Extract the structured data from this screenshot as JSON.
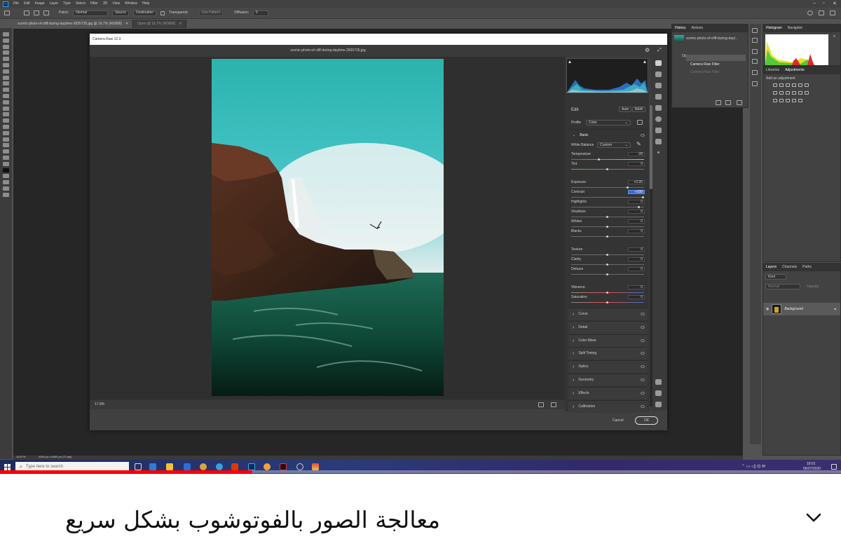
{
  "menu": [
    "File",
    "Edit",
    "Image",
    "Layer",
    "Type",
    "Select",
    "Filter",
    "3D",
    "View",
    "Window",
    "Help"
  ],
  "options": {
    "patch_label": "Patch:",
    "patch_value": "Normal",
    "source": "Source",
    "destination": "Destination",
    "transparent": "Transparent",
    "use_pattern": "Use Pattern",
    "diffusion_label": "Diffusion:",
    "diffusion_value": "5"
  },
  "doc_tabs": [
    "scenic-photo-of-cliff-during-daytime-2835735.jpg @ 16.7% (RGB/8)",
    "Open @ 16.7% (RGB/8)"
  ],
  "camera_raw": {
    "title": "Camera Raw 12.3",
    "filename": "scenic-photo-of-cliff-during-daytime-2835735.jpg",
    "zoom": "17.8%",
    "cancel": "Cancel",
    "ok": "OK"
  },
  "edit_panel": {
    "title": "Edit",
    "auto": "Auto",
    "bw": "B&W",
    "profile_label": "Profile",
    "profile_value": "Color",
    "basic": "Basic",
    "white_balance_label": "White Balance",
    "white_balance_value": "Custom",
    "sliders": [
      {
        "label": "Temperature",
        "value": "-28",
        "pos": 0.38
      },
      {
        "label": "Tint",
        "value": "0",
        "pos": 0.5
      },
      {
        "label": "Exposure",
        "value": "+0.95",
        "pos": 0.78
      },
      {
        "label": "Contrast",
        "value": "+100",
        "pos": 1.0,
        "highlight": true
      },
      {
        "label": "Highlights",
        "value": "0",
        "pos": 0.94
      },
      {
        "label": "Shadows",
        "value": "0",
        "pos": 0.5
      },
      {
        "label": "Whites",
        "value": "0",
        "pos": 0.5
      },
      {
        "label": "Blacks",
        "value": "0",
        "pos": 0.5
      },
      {
        "label": "Texture",
        "value": "0",
        "pos": 0.5
      },
      {
        "label": "Clarity",
        "value": "0",
        "pos": 0.5
      },
      {
        "label": "Dehaze",
        "value": "0",
        "pos": 0.5
      },
      {
        "label": "Vibrance",
        "value": "0",
        "pos": 0.5
      },
      {
        "label": "Saturation",
        "value": "0",
        "pos": 0.5
      }
    ],
    "sections": [
      "Curve",
      "Detail",
      "Color Mixer",
      "Split Toning",
      "Optics",
      "Geometry",
      "Effects",
      "Calibration"
    ]
  },
  "history": {
    "tabs": [
      "History",
      "Actions"
    ],
    "snapshot": "scenic-photo-of-cliff-during-dayt...",
    "items": [
      "Open",
      "Camera Raw Filter",
      "Camera Raw Filter"
    ]
  },
  "histogram_panel": {
    "tabs": [
      "Histogram",
      "Navigator"
    ]
  },
  "adjustments_panel": {
    "tabs": [
      "Libraries",
      "Adjustments"
    ],
    "add_label": "Add an adjustment"
  },
  "layers_panel": {
    "tabs": [
      "Layers",
      "Channels",
      "Paths"
    ],
    "kind": "Kind",
    "mode": "Normal",
    "opacity": "Opacity:",
    "layer_name": "Background"
  },
  "status": {
    "zoom": "16.67%",
    "size": "4000 px x 6000 px (72 ppi)"
  },
  "taskbar": {
    "search_placeholder": "Type here to search",
    "time": "18:01",
    "date": "06/07/2020"
  },
  "video": {
    "progress": 0.3,
    "title": "معالجة الصور بالفوتوشوب بشكل سريع"
  }
}
